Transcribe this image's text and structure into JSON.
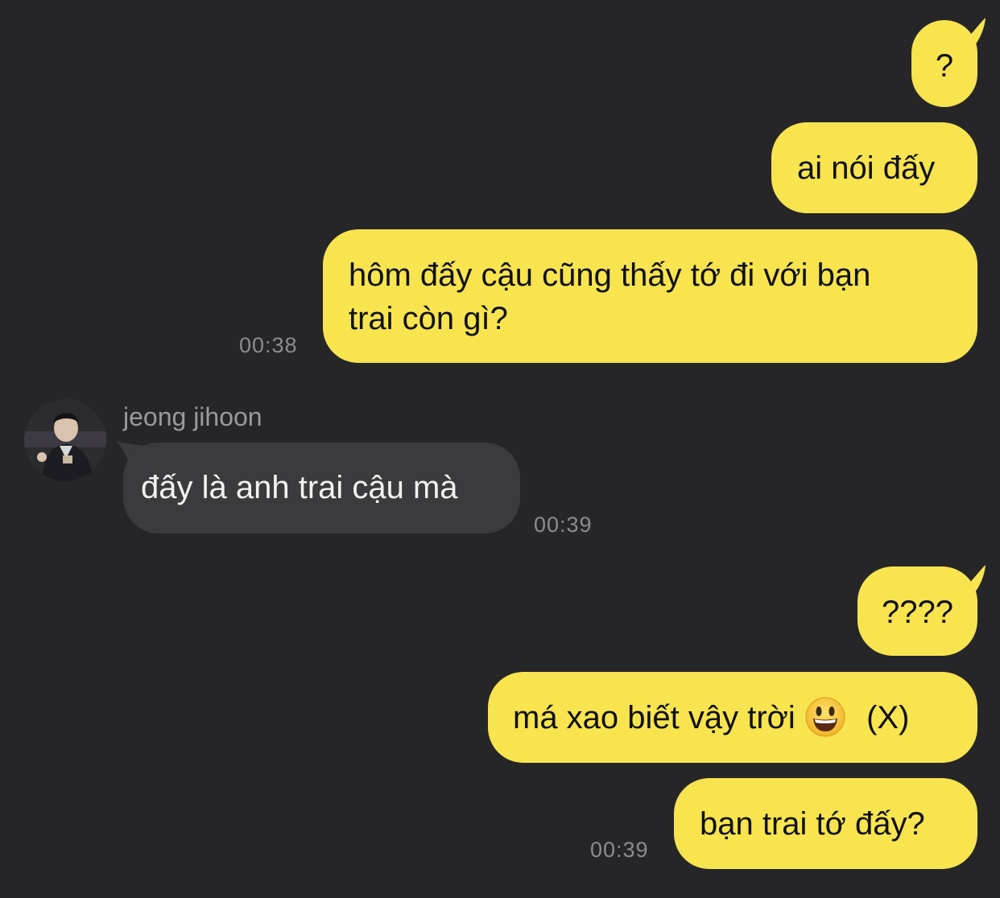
{
  "messages": {
    "m1": "?",
    "m2": "ai nói đấy",
    "m3_line1": "hôm đấy cậu cũng thấy tớ đi với bạn",
    "m3_line2": "trai còn gì?",
    "m3_time": "00:38",
    "sender_name": "jeong jihoon",
    "m4": "đấy là anh trai cậu mà",
    "m4_time": "00:39",
    "m5": "????",
    "m6_before": "má xao biết vậy trời",
    "m6_emoji": "smiley-emoji-icon",
    "m6_after": "(X)",
    "m7": "bạn trai tớ đấy?",
    "m7_time": "00:39"
  },
  "colors": {
    "background": "#262628",
    "my_bubble": "#f8e44f",
    "their_bubble": "#3b3b3d",
    "timestamp": "#8c8c8f"
  }
}
